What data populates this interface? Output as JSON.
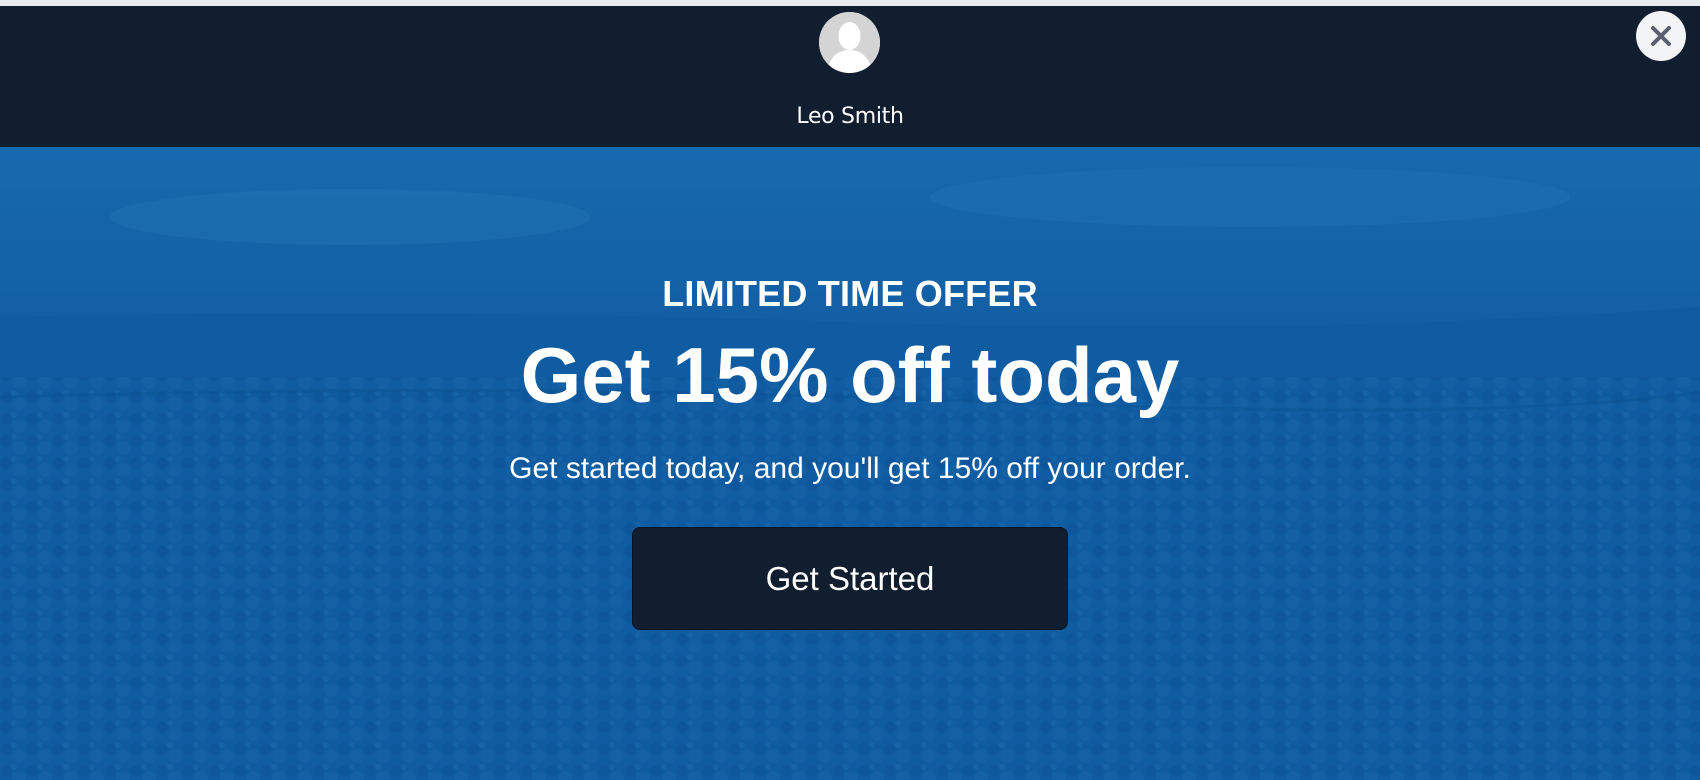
{
  "header": {
    "author_name": "Leo Smith",
    "avatar_icon": "default-user-avatar-icon",
    "close_icon": "close-icon"
  },
  "promo": {
    "eyebrow": "LIMITED TIME OFFER",
    "headline": "Get 15% off today",
    "subtext": "Get started today, and you'll get 15% off your order.",
    "cta_label": "Get Started"
  },
  "colors": {
    "header_bg": "#111e30",
    "hero_bg": "#0e5aa3",
    "button_bg": "#111e30",
    "text": "#ffffff",
    "close_bg": "#f3f4f6",
    "close_icon": "#5a6070"
  }
}
